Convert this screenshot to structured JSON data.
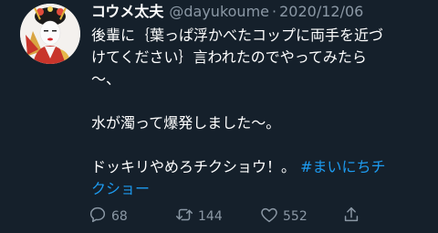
{
  "user": {
    "display_name": "コウメ太夫",
    "handle": "@dayukoume",
    "separator": "·",
    "date": "2020/12/06"
  },
  "tweet": {
    "lines": [
      "後輩に｛葉っぱ浮かべたコップに両手を近づ",
      "けてください｝言われたのでやってみたら",
      "〜、"
    ],
    "line4": "水が濁って爆発しました〜。",
    "line5_text": "ドッキリやめろチクショウ！。",
    "line5_hashtag": "#まいにちチ",
    "line6_hashtag": "クショー"
  },
  "actions": {
    "reply_count": "68",
    "retweet_count": "144",
    "like_count": "552"
  },
  "icons": {
    "reply": "reply-icon",
    "retweet": "retweet-icon",
    "like": "heart-icon",
    "share": "share-icon"
  },
  "colors": {
    "background": "#15202b",
    "muted": "#8b98a5",
    "link": "#1d9bf0"
  }
}
